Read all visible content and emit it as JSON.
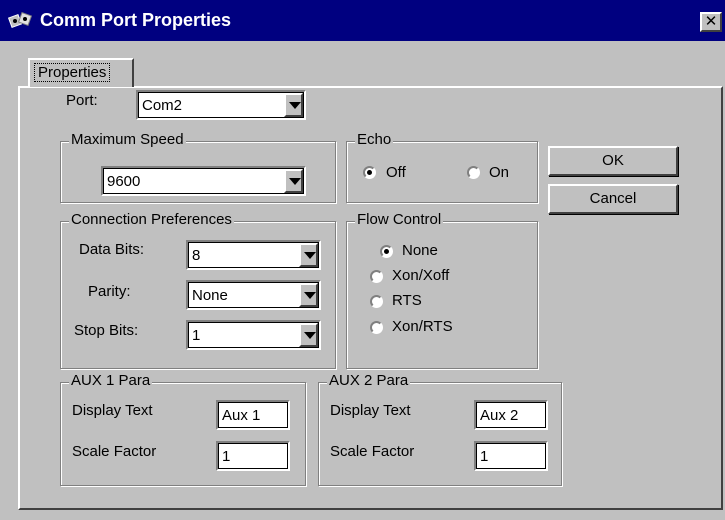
{
  "window": {
    "title": "Comm Port Properties",
    "close_glyph": "✕",
    "title_icon": "comm-ports-icon"
  },
  "tab": {
    "label": "Properties"
  },
  "port": {
    "label": "Port:",
    "value": "Com2"
  },
  "max_speed": {
    "legend": "Maximum Speed",
    "value": "9600"
  },
  "echo": {
    "legend": "Echo",
    "options": [
      {
        "label": "Off",
        "checked": true
      },
      {
        "label": "On",
        "checked": false
      }
    ]
  },
  "buttons": {
    "ok": "OK",
    "cancel": "Cancel"
  },
  "connection": {
    "legend": "Connection Preferences",
    "data_bits": {
      "label": "Data Bits:",
      "value": "8"
    },
    "parity": {
      "label": "Parity:",
      "value": "None"
    },
    "stop_bits": {
      "label": "Stop Bits:",
      "value": "1"
    }
  },
  "flow_control": {
    "legend": "Flow Control",
    "options": [
      {
        "label": "None",
        "checked": true
      },
      {
        "label": "Xon/Xoff",
        "checked": false
      },
      {
        "label": "RTS",
        "checked": false
      },
      {
        "label": "Xon/RTS",
        "checked": false
      }
    ]
  },
  "aux1": {
    "legend": "AUX 1 Para",
    "display_label": "Display Text",
    "display_value": "Aux 1",
    "scale_label": "Scale Factor",
    "scale_value": "1"
  },
  "aux2": {
    "legend": "AUX 2 Para",
    "display_label": "Display Text",
    "display_value": "Aux 2",
    "scale_label": "Scale Factor",
    "scale_value": "1"
  },
  "colors": {
    "titlebar": "#000080",
    "face": "#c0c0c0"
  }
}
